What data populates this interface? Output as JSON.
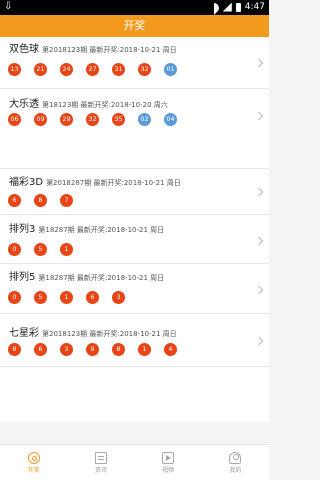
{
  "status_bar": {
    "time": "4:47"
  },
  "header": {
    "title": "开奖"
  },
  "lotteries": [
    {
      "name": "双色球",
      "issue": "第2018123期 最新开奖:2018-10-21 周日",
      "balls": [
        {
          "n": "13",
          "c": "red"
        },
        {
          "n": "21",
          "c": "red"
        },
        {
          "n": "24",
          "c": "red"
        },
        {
          "n": "27",
          "c": "red"
        },
        {
          "n": "31",
          "c": "red"
        },
        {
          "n": "32",
          "c": "red"
        },
        {
          "n": "01",
          "c": "blue"
        }
      ]
    },
    {
      "name": "大乐透",
      "issue": "第18123期 最新开奖:2018-10-20 周六",
      "balls": [
        {
          "n": "06",
          "c": "red"
        },
        {
          "n": "09",
          "c": "red"
        },
        {
          "n": "29",
          "c": "red"
        },
        {
          "n": "32",
          "c": "red"
        },
        {
          "n": "35",
          "c": "red"
        },
        {
          "n": "02",
          "c": "blue"
        },
        {
          "n": "04",
          "c": "blue"
        }
      ]
    },
    {
      "name": "福彩3D",
      "issue": "第2018287期 最新开奖:2018-10-21 周日",
      "balls": [
        {
          "n": "6",
          "c": "red"
        },
        {
          "n": "8",
          "c": "red"
        },
        {
          "n": "7",
          "c": "red"
        }
      ]
    },
    {
      "name": "排列3",
      "issue": "第18287期 最新开奖:2018-10-21 周日",
      "balls": [
        {
          "n": "0",
          "c": "red"
        },
        {
          "n": "5",
          "c": "red"
        },
        {
          "n": "1",
          "c": "red"
        }
      ]
    },
    {
      "name": "排列5",
      "issue": "第18287期 最新开奖:2018-10-21 周日",
      "balls": [
        {
          "n": "0",
          "c": "red"
        },
        {
          "n": "5",
          "c": "red"
        },
        {
          "n": "1",
          "c": "red"
        },
        {
          "n": "6",
          "c": "red"
        },
        {
          "n": "3",
          "c": "red"
        }
      ]
    },
    {
      "name": "七星彩",
      "issue": "第2018123期 最新开奖:2018-10-21 周日",
      "balls": [
        {
          "n": "8",
          "c": "red"
        },
        {
          "n": "6",
          "c": "red"
        },
        {
          "n": "3",
          "c": "red"
        },
        {
          "n": "9",
          "c": "red"
        },
        {
          "n": "8",
          "c": "red"
        },
        {
          "n": "1",
          "c": "red"
        },
        {
          "n": "4",
          "c": "red"
        }
      ]
    }
  ],
  "tabs": [
    {
      "label": "开奖",
      "icon": "lottery-icon",
      "active": true
    },
    {
      "label": "资讯",
      "icon": "news-icon",
      "active": false
    },
    {
      "label": "视频",
      "icon": "video-icon",
      "active": false
    },
    {
      "label": "我的",
      "icon": "profile-icon",
      "active": false
    }
  ],
  "colors": {
    "accent": "#f39a1e",
    "red_ball": "#e84415",
    "blue_ball": "#5b9ad8"
  }
}
